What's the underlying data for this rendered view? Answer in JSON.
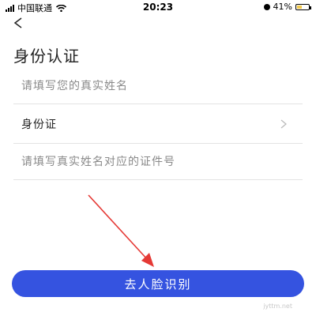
{
  "status_bar": {
    "carrier": "中国联通",
    "time": "20:23",
    "battery": "41%",
    "battery_level": 0.41
  },
  "header": {
    "back_label": "<",
    "title": "身份认证"
  },
  "form": {
    "name_placeholder": "请填写您的真实姓名",
    "id_type_label": "身份证",
    "id_number_placeholder": "请填写真实姓名对应的证件号"
  },
  "action": {
    "face_button_label": "去人脸识别"
  },
  "annotation": {
    "arrow_color": "#e53935"
  },
  "colors": {
    "accent": "#3553e0"
  },
  "watermark": "jyttm.net"
}
